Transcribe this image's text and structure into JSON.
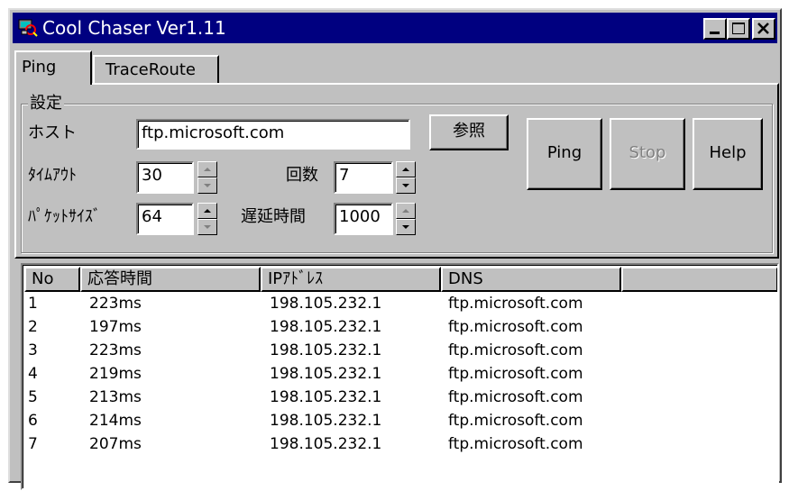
{
  "window": {
    "title": "Cool Chaser Ver1.11"
  },
  "tabs": [
    {
      "label": "Ping"
    },
    {
      "label": "TraceRoute"
    }
  ],
  "settings": {
    "group_label": "設定",
    "host_label": "ホスト",
    "host_value": "ftp.microsoft.com",
    "browse_label": "参照",
    "timeout_label": "ﾀｲﾑｱｳﾄ",
    "timeout_value": "30",
    "count_label": "回数",
    "count_value": "7",
    "packet_size_label": "ﾊﾟｹｯﾄｻｲｽﾞ",
    "packet_size_value": "64",
    "delay_label": "遅延時間",
    "delay_value": "1000"
  },
  "actions": {
    "ping_label": "Ping",
    "stop_label": "Stop",
    "help_label": "Help"
  },
  "results": {
    "columns": [
      "No",
      "応答時間",
      "IPｱﾄﾞﾚｽ",
      "DNS"
    ],
    "rows": [
      {
        "no": "1",
        "time": "223ms",
        "ip": "198.105.232.1",
        "dns": "ftp.microsoft.com"
      },
      {
        "no": "2",
        "time": "197ms",
        "ip": "198.105.232.1",
        "dns": "ftp.microsoft.com"
      },
      {
        "no": "3",
        "time": "223ms",
        "ip": "198.105.232.1",
        "dns": "ftp.microsoft.com"
      },
      {
        "no": "4",
        "time": "219ms",
        "ip": "198.105.232.1",
        "dns": "ftp.microsoft.com"
      },
      {
        "no": "5",
        "time": "213ms",
        "ip": "198.105.232.1",
        "dns": "ftp.microsoft.com"
      },
      {
        "no": "6",
        "time": "214ms",
        "ip": "198.105.232.1",
        "dns": "ftp.microsoft.com"
      },
      {
        "no": "7",
        "time": "207ms",
        "ip": "198.105.232.1",
        "dns": "ftp.microsoft.com"
      }
    ]
  },
  "colors": {
    "titlebar": "#000080",
    "face": "#c0c0c0"
  }
}
